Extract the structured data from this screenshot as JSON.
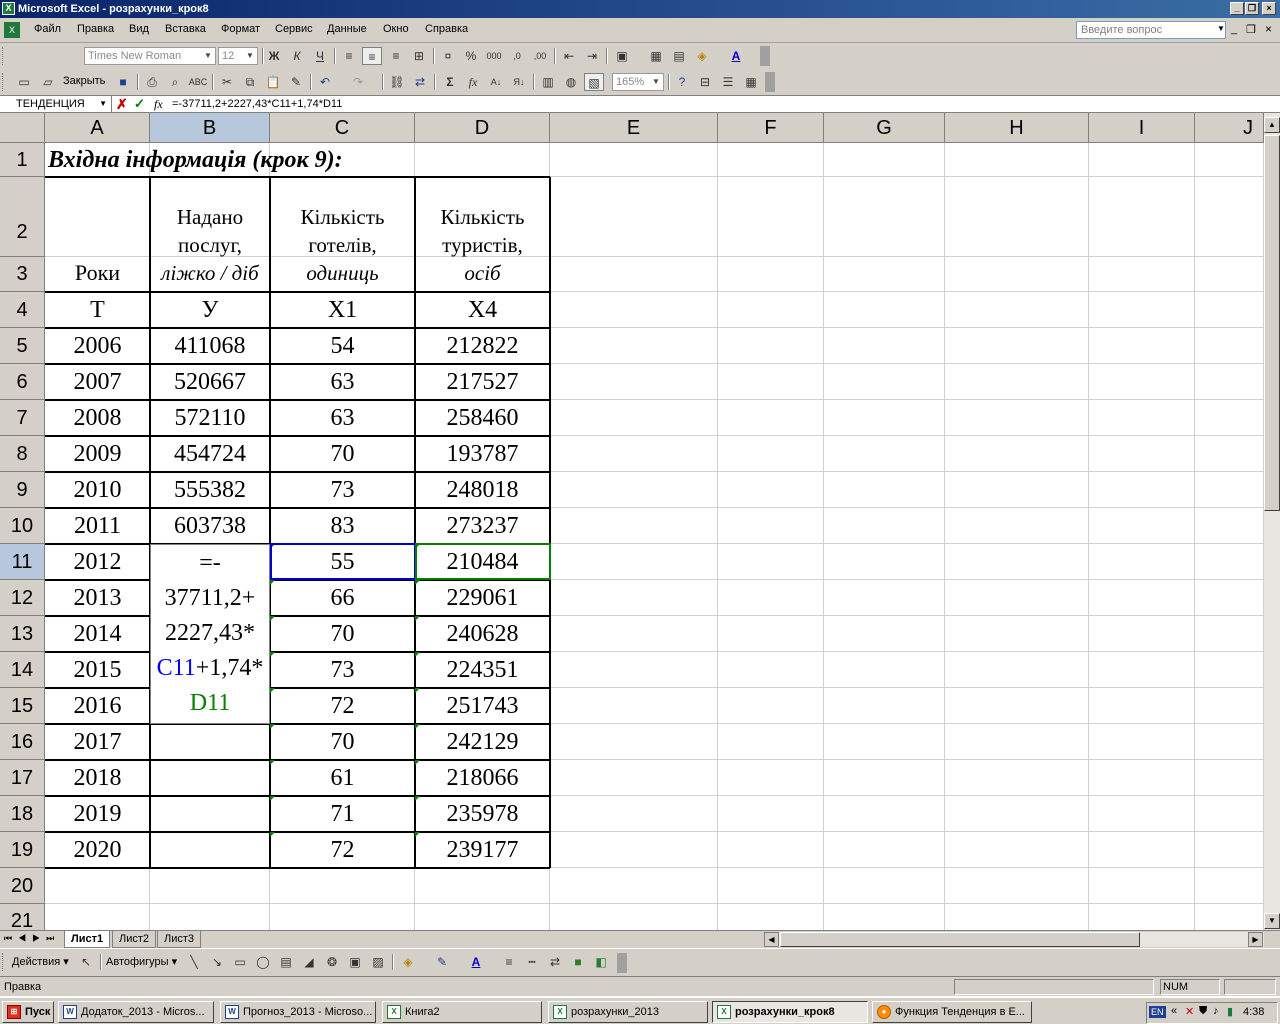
{
  "window": {
    "title": "Microsoft Excel - розрахунки_крок8"
  },
  "menu": [
    "Файл",
    "Правка",
    "Вид",
    "Вставка",
    "Формат",
    "Сервис",
    "Данные",
    "Окно",
    "Справка"
  ],
  "ask": {
    "placeholder": "Введите вопрос"
  },
  "toolbar": {
    "font": "Times New Roman",
    "size": "12",
    "close_label": "Закрыть",
    "zoom": "165%"
  },
  "formula": {
    "namebox": "ТЕНДЕНЦИЯ",
    "fx": "fx",
    "text": "=-37711,2+2227,43*C11+1,74*D11"
  },
  "columns": [
    "A",
    "B",
    "C",
    "D",
    "E",
    "F",
    "G",
    "H",
    "I",
    "J"
  ],
  "rows": [
    "1",
    "2",
    "3",
    "4",
    "5",
    "6",
    "7",
    "8",
    "9",
    "10",
    "11",
    "12",
    "13",
    "14",
    "15",
    "16",
    "17",
    "18",
    "19",
    "20",
    "21"
  ],
  "sheet": {
    "title": "Вхідна інформація (крок 9):",
    "h_years": "Роки",
    "h_b": {
      "l1": "Надано",
      "l2": "послуг,",
      "l3": "ліжко / діб"
    },
    "h_c": {
      "l1": "Кількість",
      "l2": "готелів,",
      "l3": "одиниць"
    },
    "h_d": {
      "l1": "Кількість",
      "l2": "туристів,",
      "l3": "осіб"
    },
    "codes": [
      "T",
      "У",
      "X1",
      "X4"
    ],
    "years": [
      "2006",
      "2007",
      "2008",
      "2009",
      "2010",
      "2011",
      "2012",
      "2013",
      "2014",
      "2015",
      "2016",
      "2017",
      "2018",
      "2019",
      "2020"
    ],
    "y": [
      "411068",
      "520667",
      "572110",
      "454724",
      "555382",
      "603738"
    ],
    "x1": [
      "54",
      "63",
      "63",
      "70",
      "73",
      "83",
      "55",
      "66",
      "70",
      "73",
      "72",
      "70",
      "61",
      "71",
      "72"
    ],
    "x4": [
      "212822",
      "217527",
      "258460",
      "193787",
      "248018",
      "273237",
      "210484",
      "229061",
      "240628",
      "224351",
      "251743",
      "242129",
      "218066",
      "235978",
      "239177"
    ],
    "edit": {
      "l1": "=-",
      "l2": "37711,2+",
      "l3": "2227,43*",
      "l4a": "C11",
      "l4b": "+1,74*",
      "l5": "D11"
    }
  },
  "tabs": [
    "Лист1",
    "Лист2",
    "Лист3"
  ],
  "draw": {
    "actions": "Действия",
    "autoshapes": "Автофигуры"
  },
  "status": {
    "mode": "Правка",
    "num": "NUM"
  },
  "taskbar": {
    "start": "Пуск",
    "items": [
      "Додаток_2013 - Micros...",
      "Прогноз_2013 - Microso...",
      "Книга2",
      "розрахунки_2013",
      "розрахунки_крок8",
      "Функция Тенденция в Е..."
    ],
    "lang": "EN",
    "time": "4:38"
  },
  "colors": {
    "ref_blue": "#0000ff",
    "ref_green": "#008000",
    "title_bar": "#0a246a"
  }
}
